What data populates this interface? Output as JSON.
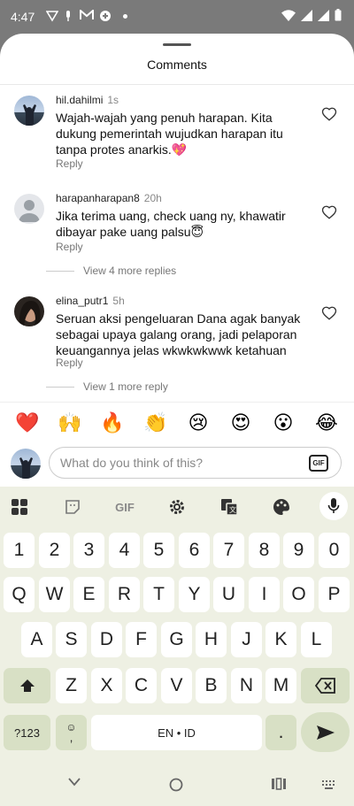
{
  "status_bar": {
    "time": "4:47"
  },
  "sheet": {
    "title": "Comments"
  },
  "comments": [
    {
      "username": "hil.dahilmi",
      "time": "1s",
      "text": "Wajah-wajah yang penuh harapan. Kita dukung pemerintah wujudkan harapan itu tanpa protes anarkis.💖",
      "reply_label": "Reply"
    },
    {
      "username": "harapanharapan8",
      "time": "20h",
      "text": "Jika terima uang, check uang ny, khawatir dibayar pake uang palsu😇",
      "reply_label": "Reply",
      "more_replies": "View 4 more replies"
    },
    {
      "username": "elina_putr1",
      "time": "5h",
      "text": "Seruan aksi pengeluaran Dana agak banyak sebagai upaya galang orang, jadi pelaporan keuangannya jelas wkwkwkwwk ketahuan",
      "reply_label": "Reply",
      "more_replies": "View 1 more reply"
    }
  ],
  "reactions": [
    "❤️",
    "🙌",
    "🔥",
    "👏",
    "😢",
    "😍",
    "😮",
    "😂"
  ],
  "composer": {
    "placeholder": "What do you think of this?",
    "gif_label": "GIF"
  },
  "keyboard": {
    "toolbar_gif": "GIF",
    "row_numbers": [
      "1",
      "2",
      "3",
      "4",
      "5",
      "6",
      "7",
      "8",
      "9",
      "0"
    ],
    "row_q": [
      "Q",
      "W",
      "E",
      "R",
      "T",
      "Y",
      "U",
      "I",
      "O",
      "P"
    ],
    "row_a": [
      "A",
      "S",
      "D",
      "F",
      "G",
      "H",
      "J",
      "K",
      "L"
    ],
    "row_z": [
      "Z",
      "X",
      "C",
      "V",
      "B",
      "N",
      "M"
    ],
    "symbols_label": "?123",
    "comma_label": ",",
    "space_label": "EN • ID",
    "period_label": "."
  }
}
